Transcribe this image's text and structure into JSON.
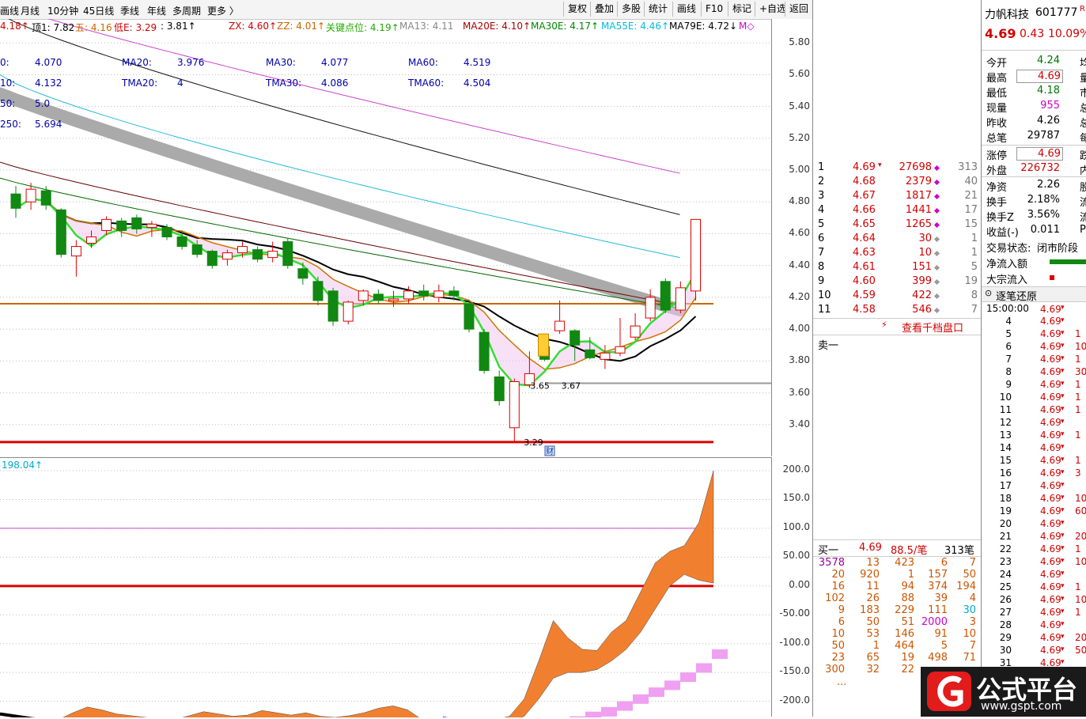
{
  "toolbar": {
    "tabs": [
      "画线",
      "月线",
      "10分钟",
      "45日线",
      "季线",
      "年线",
      "多周期",
      "更多 〉"
    ],
    "buttons": [
      "复权",
      "叠加",
      "多股",
      "统计",
      "画线",
      "F10",
      "标记",
      "+自选",
      "返回"
    ]
  },
  "ma_header": {
    "items": [
      {
        "text": "4.18↑",
        "color": "#d00000"
      },
      {
        "text": "顶1: 7.82",
        "color": "#000000"
      },
      {
        "text": "五: 4.16",
        "color": "#cc6600"
      },
      {
        "text": "低E: 3.29",
        "color": "#d00000"
      },
      {
        "text": ": 3.81↑",
        "color": "#000000"
      },
      {
        "text": "ZX: 4.60↑",
        "color": "#d00000"
      },
      {
        "text": "ZZ: 4.01↑",
        "color": "#cc6600"
      },
      {
        "text": "关键点位: 4.19↑",
        "color": "#22aa00"
      },
      {
        "text": "MA13: 4.11",
        "color": "#888888"
      },
      {
        "text": "MA20E: 4.10↑",
        "color": "#aa0000"
      },
      {
        "text": "MA30E: 4.17↑",
        "color": "#008800"
      },
      {
        "text": "MA55E: 4.46↑",
        "color": "#00bbdd"
      },
      {
        "text": "MA79E: 4.72↓",
        "color": "#000000"
      },
      {
        "text": "M◇",
        "color": "#cc00cc"
      }
    ]
  },
  "ma_values": [
    {
      "label": "0:",
      "value": "4.070"
    },
    {
      "label": "MA20:",
      "value": "3.976"
    },
    {
      "label": "MA30:",
      "value": "4.077"
    },
    {
      "label": "MA60:",
      "value": "4.519"
    },
    {
      "label": "10:",
      "value": "4.132"
    },
    {
      "label": "TMA20:",
      "value": "4"
    },
    {
      "label": "TMA30:",
      "value": "4.086"
    },
    {
      "label": "TMA60:",
      "value": "4.504"
    },
    {
      "label": "50:",
      "value": "5.0"
    },
    {
      "label": "250:",
      "value": "5.694"
    }
  ],
  "price_axis": [
    "5.80",
    "5.60",
    "5.40",
    "5.20",
    "5.00",
    "4.80",
    "4.60",
    "4.40",
    "4.20",
    "4.00",
    "3.80",
    "3.60",
    "3.40"
  ],
  "indicator_axis": [
    "200.0",
    "150.0",
    "100.0",
    "50.00",
    "0.00",
    "-50.00",
    "-100.0",
    "-150.0",
    "-200.0"
  ],
  "indicator_header": "198.04↑",
  "chart_labels": {
    "low": "3.29",
    "low2": "3.65",
    "low3": "3.67",
    "fin_icon": "财"
  },
  "chart_data": {
    "type": "candlestick",
    "ylim": [
      3.2,
      5.95
    ],
    "candles": [
      {
        "o": 4.85,
        "c": 4.76,
        "h": 4.9,
        "l": 4.7
      },
      {
        "o": 4.8,
        "c": 4.88,
        "h": 4.92,
        "l": 4.75
      },
      {
        "o": 4.87,
        "c": 4.78,
        "h": 4.9,
        "l": 4.75
      },
      {
        "o": 4.75,
        "c": 4.47,
        "h": 4.76,
        "l": 4.45
      },
      {
        "o": 4.46,
        "c": 4.52,
        "h": 4.56,
        "l": 4.33
      },
      {
        "o": 4.54,
        "c": 4.58,
        "h": 4.62,
        "l": 4.51
      },
      {
        "o": 4.62,
        "c": 4.69,
        "h": 4.71,
        "l": 4.59
      },
      {
        "o": 4.68,
        "c": 4.62,
        "h": 4.7,
        "l": 4.58
      },
      {
        "o": 4.7,
        "c": 4.63,
        "h": 4.72,
        "l": 4.6
      },
      {
        "o": 4.64,
        "c": 4.66,
        "h": 4.68,
        "l": 4.58
      },
      {
        "o": 4.64,
        "c": 4.58,
        "h": 4.66,
        "l": 4.56
      },
      {
        "o": 4.58,
        "c": 4.52,
        "h": 4.62,
        "l": 4.5
      },
      {
        "o": 4.53,
        "c": 4.47,
        "h": 4.56,
        "l": 4.45
      },
      {
        "o": 4.49,
        "c": 4.4,
        "h": 4.5,
        "l": 4.38
      },
      {
        "o": 4.44,
        "c": 4.48,
        "h": 4.5,
        "l": 4.4
      },
      {
        "o": 4.48,
        "c": 4.52,
        "h": 4.55,
        "l": 4.45
      },
      {
        "o": 4.5,
        "c": 4.44,
        "h": 4.52,
        "l": 4.42
      },
      {
        "o": 4.45,
        "c": 4.49,
        "h": 4.55,
        "l": 4.42
      },
      {
        "o": 4.55,
        "c": 4.4,
        "h": 4.57,
        "l": 4.38
      },
      {
        "o": 4.38,
        "c": 4.32,
        "h": 4.42,
        "l": 4.28
      },
      {
        "o": 4.3,
        "c": 4.18,
        "h": 4.33,
        "l": 4.15
      },
      {
        "o": 4.24,
        "c": 4.05,
        "h": 4.26,
        "l": 4.02
      },
      {
        "o": 4.05,
        "c": 4.17,
        "h": 4.18,
        "l": 4.03
      },
      {
        "o": 4.18,
        "c": 4.24,
        "h": 4.25,
        "l": 4.15
      },
      {
        "o": 4.22,
        "c": 4.18,
        "h": 4.25,
        "l": 4.16
      },
      {
        "o": 4.18,
        "c": 4.19,
        "h": 4.24,
        "l": 4.14
      },
      {
        "o": 4.19,
        "c": 4.24,
        "h": 4.27,
        "l": 4.16
      },
      {
        "o": 4.24,
        "c": 4.21,
        "h": 4.28,
        "l": 4.18
      },
      {
        "o": 4.2,
        "c": 4.24,
        "h": 4.28,
        "l": 4.17
      },
      {
        "o": 4.24,
        "c": 4.21,
        "h": 4.27,
        "l": 4.18
      },
      {
        "o": 4.16,
        "c": 4.0,
        "h": 4.18,
        "l": 3.98
      },
      {
        "o": 3.98,
        "c": 3.74,
        "h": 4.0,
        "l": 3.72
      },
      {
        "o": 3.7,
        "c": 3.55,
        "h": 3.74,
        "l": 3.52
      },
      {
        "o": 3.38,
        "c": 3.67,
        "h": 3.69,
        "l": 3.29
      },
      {
        "o": 3.65,
        "c": 3.72,
        "h": 3.86,
        "l": 3.63
      },
      {
        "o": 3.89,
        "c": 3.81,
        "h": 3.92,
        "l": 3.8
      },
      {
        "o": 3.99,
        "c": 4.05,
        "h": 4.18,
        "l": 3.97
      },
      {
        "o": 3.99,
        "c": 3.9,
        "h": 4.0,
        "l": 3.8
      },
      {
        "o": 3.87,
        "c": 3.82,
        "h": 3.95,
        "l": 3.81
      },
      {
        "o": 3.81,
        "c": 3.85,
        "h": 3.9,
        "l": 3.75
      },
      {
        "o": 3.85,
        "c": 3.89,
        "h": 4.07,
        "l": 3.83
      },
      {
        "o": 3.95,
        "c": 4.02,
        "h": 4.1,
        "l": 3.93
      },
      {
        "o": 4.07,
        "c": 4.2,
        "h": 4.25,
        "l": 4.05
      },
      {
        "o": 4.3,
        "c": 4.12,
        "h": 4.32,
        "l": 4.1
      },
      {
        "o": 4.12,
        "c": 4.26,
        "h": 4.3,
        "l": 4.1
      },
      {
        "o": 4.24,
        "c": 4.69,
        "h": 4.69,
        "l": 4.18
      }
    ]
  },
  "orderbook": {
    "sells": [
      {
        "n": "1",
        "p": "4.69",
        "v": "27698",
        "t": "313",
        "arrow": "▾"
      },
      {
        "n": "2",
        "p": "4.68",
        "v": "2379",
        "t": "40"
      },
      {
        "n": "3",
        "p": "4.67",
        "v": "1817",
        "t": "21"
      },
      {
        "n": "4",
        "p": "4.66",
        "v": "1441",
        "t": "17"
      },
      {
        "n": "5",
        "p": "4.65",
        "v": "1265",
        "t": "15"
      },
      {
        "n": "6",
        "p": "4.64",
        "v": "30",
        "t": "1"
      },
      {
        "n": "7",
        "p": "4.63",
        "v": "10",
        "t": "1"
      },
      {
        "n": "8",
        "p": "4.61",
        "v": "151",
        "t": "5"
      },
      {
        "n": "9",
        "p": "4.60",
        "v": "399",
        "t": "19"
      },
      {
        "n": "10",
        "p": "4.59",
        "v": "422",
        "t": "8"
      },
      {
        "n": "11",
        "p": "4.58",
        "v": "546",
        "t": "7"
      }
    ],
    "view_more": "查看千档盘口",
    "sell_one": "卖一",
    "buy_one": "买一",
    "buy_one_price": "4.69",
    "buy_one_vol": "88.5/笔",
    "buy_one_count": "313笔",
    "queue": [
      [
        "3578",
        "13",
        "423",
        "6",
        "7"
      ],
      [
        "20",
        "920",
        "1",
        "157",
        "50"
      ],
      [
        "16",
        "11",
        "94",
        "374",
        "194"
      ],
      [
        "102",
        "26",
        "88",
        "39",
        "4"
      ],
      [
        "9",
        "183",
        "229",
        "111",
        "30"
      ],
      [
        "6",
        "50",
        "51",
        "2000",
        "3"
      ],
      [
        "10",
        "53",
        "146",
        "91",
        "10"
      ],
      [
        "50",
        "1",
        "464",
        "5",
        "7"
      ],
      [
        "23",
        "65",
        "19",
        "498",
        "71"
      ],
      [
        "300",
        "32",
        "22",
        "",
        ""
      ]
    ],
    "ellipsis": "..."
  },
  "quote": {
    "name": "力帆科技",
    "code": "601777",
    "tag": "R",
    "price": "4.69",
    "change": "0.43",
    "pct": "10.09%",
    "right1": "均",
    "rows1": [
      {
        "k": "今开",
        "v": "4.24",
        "c": "grn",
        "x": "均"
      },
      {
        "k": "最高",
        "v": "4.69",
        "c": "red",
        "box": true,
        "x": "量"
      },
      {
        "k": "最低",
        "v": "4.18",
        "c": "grn",
        "x": "市"
      },
      {
        "k": "现量",
        "v": "955",
        "c": "mag",
        "x": "总"
      },
      {
        "k": "昨收",
        "v": "4.26",
        "c": "",
        "x": "总"
      },
      {
        "k": "总笔",
        "v": "29787",
        "c": "",
        "x": "每"
      }
    ],
    "rows2": [
      {
        "k": "涨停",
        "v": "4.69",
        "c": "red",
        "box": true,
        "x": "跌"
      },
      {
        "k": "外盘",
        "v": "226732",
        "c": "red",
        "x": "内"
      }
    ],
    "rows3": [
      {
        "k": "净资",
        "v": "2.26",
        "x": "股"
      },
      {
        "k": "换手",
        "v": "2.18%",
        "x": "流"
      },
      {
        "k": "换手Z",
        "v": "3.56%",
        "x": "流"
      },
      {
        "k": "收益(-)",
        "v": "0.011",
        "x": "P"
      }
    ],
    "status_label": "交易状态:",
    "status": "闭市阶段",
    "net_inflow": "净流入额",
    "big_inflow": "大宗流入",
    "ticks_title": "逐笔还原",
    "first_time": "15:00:00",
    "tick_price": "4.69",
    "tick_arrow": "▾",
    "tick_rows": [
      "4",
      "5",
      "6",
      "7",
      "8",
      "9",
      "10",
      "11",
      "12",
      "13",
      "14",
      "15",
      "16",
      "17",
      "18",
      "19",
      "20",
      "21",
      "22",
      "23",
      "24",
      "25",
      "26",
      "27",
      "28",
      "29",
      "30",
      "31"
    ],
    "tick_extra": [
      "",
      "1",
      "10",
      "1",
      "30",
      "1",
      "1",
      "1",
      "",
      "1",
      "",
      "1",
      "3",
      "",
      "10",
      "60",
      "",
      "20",
      "1",
      "10",
      "",
      "1",
      "10",
      "1",
      "",
      "20",
      "50",
      ""
    ]
  },
  "watermark": {
    "brand": "公式平台",
    "url": "www.gspt.com"
  }
}
